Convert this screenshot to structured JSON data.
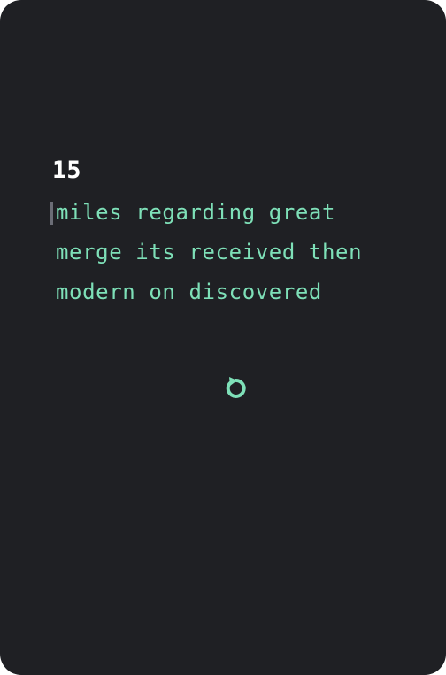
{
  "test": {
    "word_count": "15",
    "lines": [
      "miles regarding great",
      "merge its received then",
      "modern on discovered"
    ]
  },
  "controls": {
    "restart_icon": "restart-icon"
  },
  "colors": {
    "background": "#1f2024",
    "text": "#7ee0b8",
    "counter": "#ffffff",
    "caret": "#6b6d76"
  }
}
